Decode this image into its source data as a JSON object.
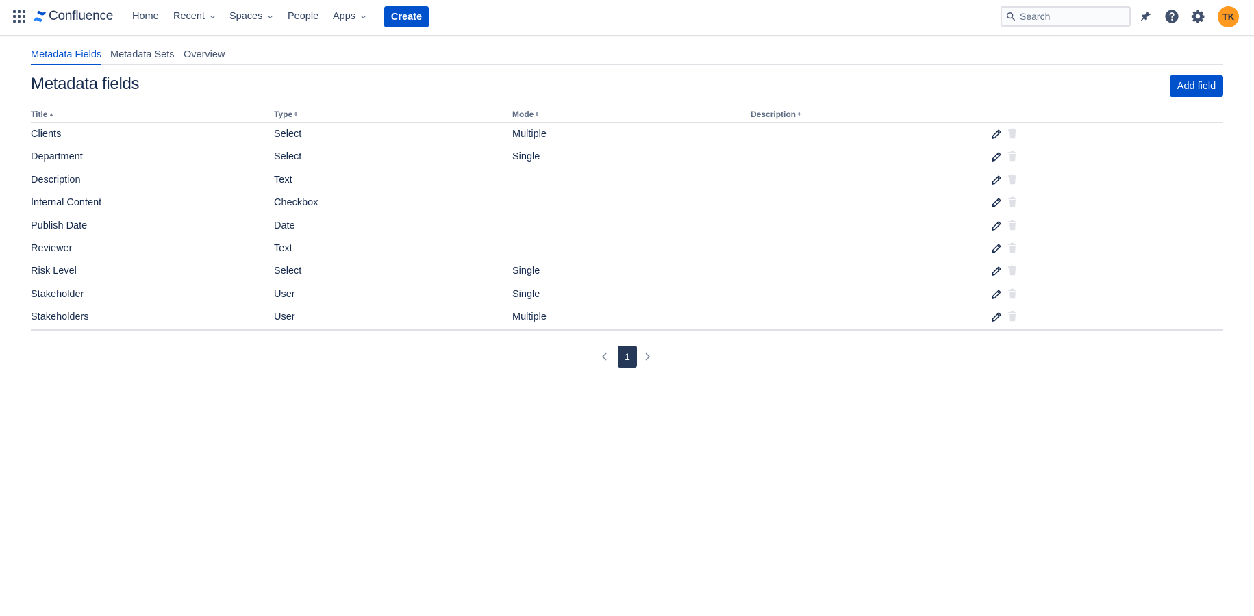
{
  "app": {
    "logo_text": "Confluence",
    "brand_color": "#0052cc",
    "app_switcher_icon": "grid-icon",
    "logo_icon": "confluence-logo-icon"
  },
  "nav": {
    "home": "Home",
    "recent": "Recent",
    "spaces": "Spaces",
    "people": "People",
    "apps": "Apps",
    "create": "Create"
  },
  "search": {
    "placeholder": "Search"
  },
  "header_icons": [
    "notifications-icon",
    "help-icon",
    "settings-icon"
  ],
  "user": {
    "initials": "TK",
    "avatar_color": "#ff991f"
  },
  "tabs": [
    {
      "label": "Metadata Fields",
      "active": true
    },
    {
      "label": "Metadata Sets",
      "active": false
    },
    {
      "label": "Overview",
      "active": false
    }
  ],
  "page": {
    "title": "Metadata fields",
    "add_button": "Add field"
  },
  "table": {
    "columns": [
      "Title",
      "Type",
      "Mode",
      "Description"
    ],
    "sorted_column": "Title",
    "sort_direction": "ascending",
    "rows": [
      {
        "title": "Clients",
        "type": "Select",
        "mode": "Multiple",
        "description": ""
      },
      {
        "title": "Department",
        "type": "Select",
        "mode": "Single",
        "description": ""
      },
      {
        "title": "Description",
        "type": "Text",
        "mode": "",
        "description": ""
      },
      {
        "title": "Internal Content",
        "type": "Checkbox",
        "mode": "",
        "description": ""
      },
      {
        "title": "Publish Date",
        "type": "Date",
        "mode": "",
        "description": ""
      },
      {
        "title": "Reviewer",
        "type": "Text",
        "mode": "",
        "description": ""
      },
      {
        "title": "Risk Level",
        "type": "Select",
        "mode": "Single",
        "description": ""
      },
      {
        "title": "Stakeholder",
        "type": "User",
        "mode": "Single",
        "description": ""
      },
      {
        "title": "Stakeholders",
        "type": "User",
        "mode": "Multiple",
        "description": ""
      }
    ],
    "row_actions": [
      "edit-icon",
      "trash-icon"
    ]
  },
  "pagination": {
    "current_page": "1"
  }
}
